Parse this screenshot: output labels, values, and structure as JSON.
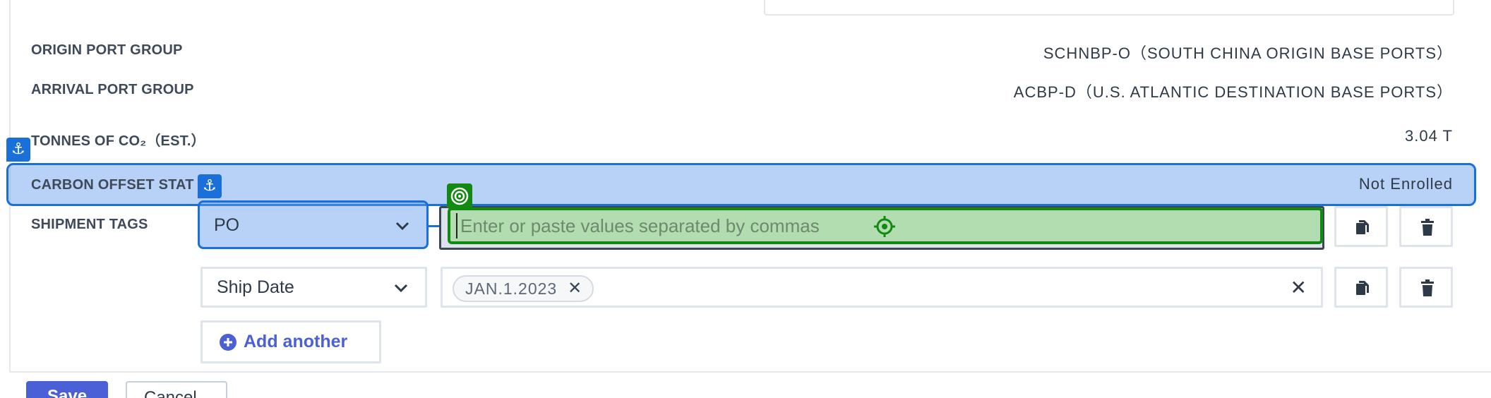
{
  "details": {
    "origin_port_group": {
      "label": "ORIGIN PORT GROUP",
      "value": "SCHNBP-O（SOUTH CHINA ORIGIN BASE PORTS）"
    },
    "arrival_port_group": {
      "label": "ARRIVAL PORT GROUP",
      "value": "ACBP-D（U.S. ATLANTIC DESTINATION BASE PORTS）"
    },
    "tonnes_co2": {
      "label": "TONNES OF CO₂（EST.）",
      "value": "3.04 T"
    },
    "carbon_offset": {
      "label": "CARBON OFFSET STAT",
      "value": "Not Enrolled"
    }
  },
  "shipment_tags": {
    "label": "SHIPMENT TAGS",
    "rows": [
      {
        "type": "PO",
        "placeholder": "Enter or paste values separated by commas"
      },
      {
        "type": "Ship Date",
        "chip": "JAN.1.2023"
      }
    ],
    "add_another": "Add another"
  },
  "footer": {
    "save": "Save",
    "cancel": "Cancel"
  },
  "overlay": {
    "anchor_glyph": "⚓"
  },
  "colors": {
    "highlight_blue": "#1a6fd9",
    "highlight_green": "#128a12",
    "accent": "#4b5fd6"
  }
}
